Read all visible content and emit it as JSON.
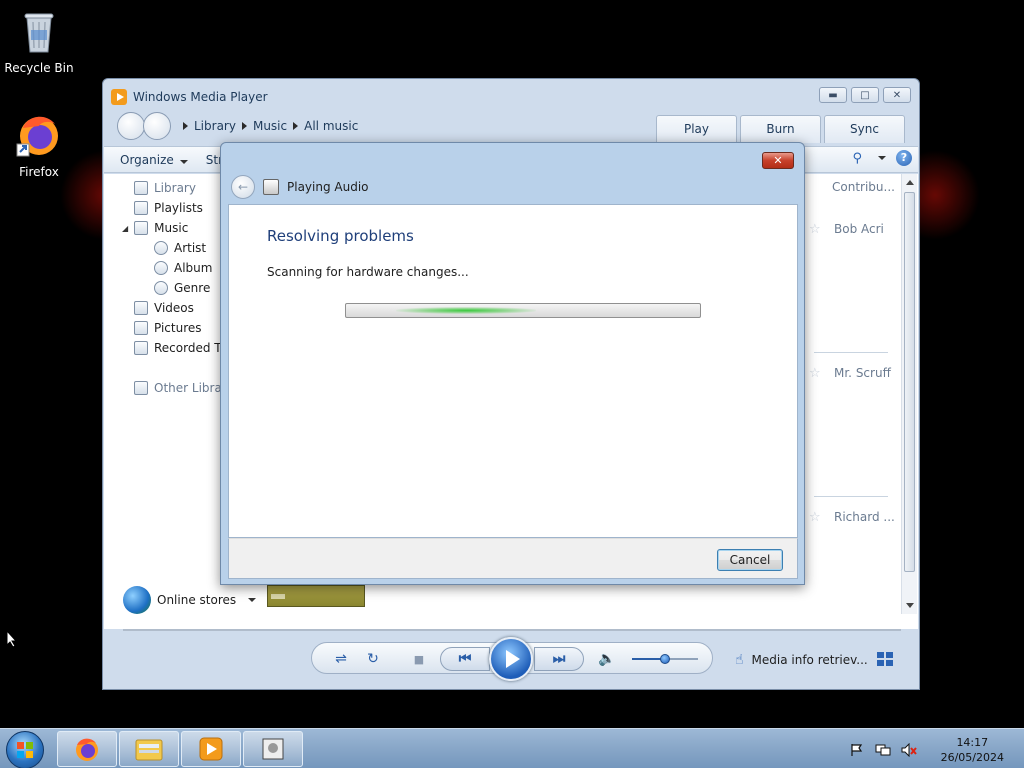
{
  "desktop": {
    "icons": [
      {
        "label": "Recycle Bin"
      },
      {
        "label": "Firefox"
      }
    ]
  },
  "wmp": {
    "title": "Windows Media Player",
    "breadcrumb": [
      "Library",
      "Music",
      "All music"
    ],
    "tabs": [
      "Play",
      "Burn",
      "Sync"
    ],
    "toolbar": {
      "organize": "Organize",
      "stream": "Stre"
    },
    "nav": [
      {
        "label": "Library",
        "muted": true
      },
      {
        "label": "Playlists"
      },
      {
        "label": "Music"
      },
      {
        "label": "Artist"
      },
      {
        "label": "Album"
      },
      {
        "label": "Genre"
      },
      {
        "label": "Videos"
      },
      {
        "label": "Pictures"
      },
      {
        "label": "Recorded TV"
      },
      {
        "label": "Other Librari",
        "muted": true
      }
    ],
    "column_header": "Contribu...",
    "artists": [
      "Bob Acri",
      "Mr. Scruff",
      "Richard ..."
    ],
    "online_stores": "Online stores",
    "media_info": "Media info retriev...",
    "volume_level": 0.5
  },
  "dialog": {
    "title": "Playing Audio",
    "heading": "Resolving problems",
    "message": "Scanning for hardware changes...",
    "cancel": "Cancel",
    "progress_indeterminate": true
  },
  "taskbar": {
    "time": "14:17",
    "date": "26/05/2024"
  },
  "colors": {
    "accent": "#2a5ea8",
    "heading": "#1f3f7a",
    "close": "#c7402a"
  }
}
